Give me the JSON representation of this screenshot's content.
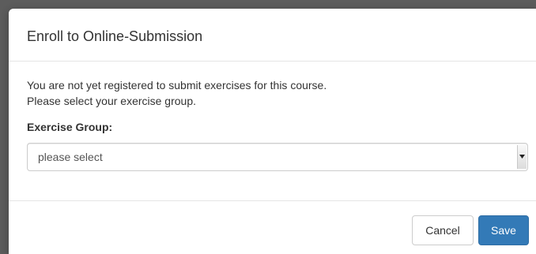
{
  "dialog": {
    "title": "Enroll to Online-Submission",
    "message_line1": "You are not yet registered to submit exercises for this course.",
    "message_line2": "Please select your exercise group.",
    "group_label": "Exercise Group:",
    "group_select": {
      "selected": "please select"
    },
    "cancel_label": "Cancel",
    "save_label": "Save"
  },
  "colors": {
    "backdrop": "#5c5c5c",
    "primary": "#337ab7",
    "text": "#333333"
  }
}
